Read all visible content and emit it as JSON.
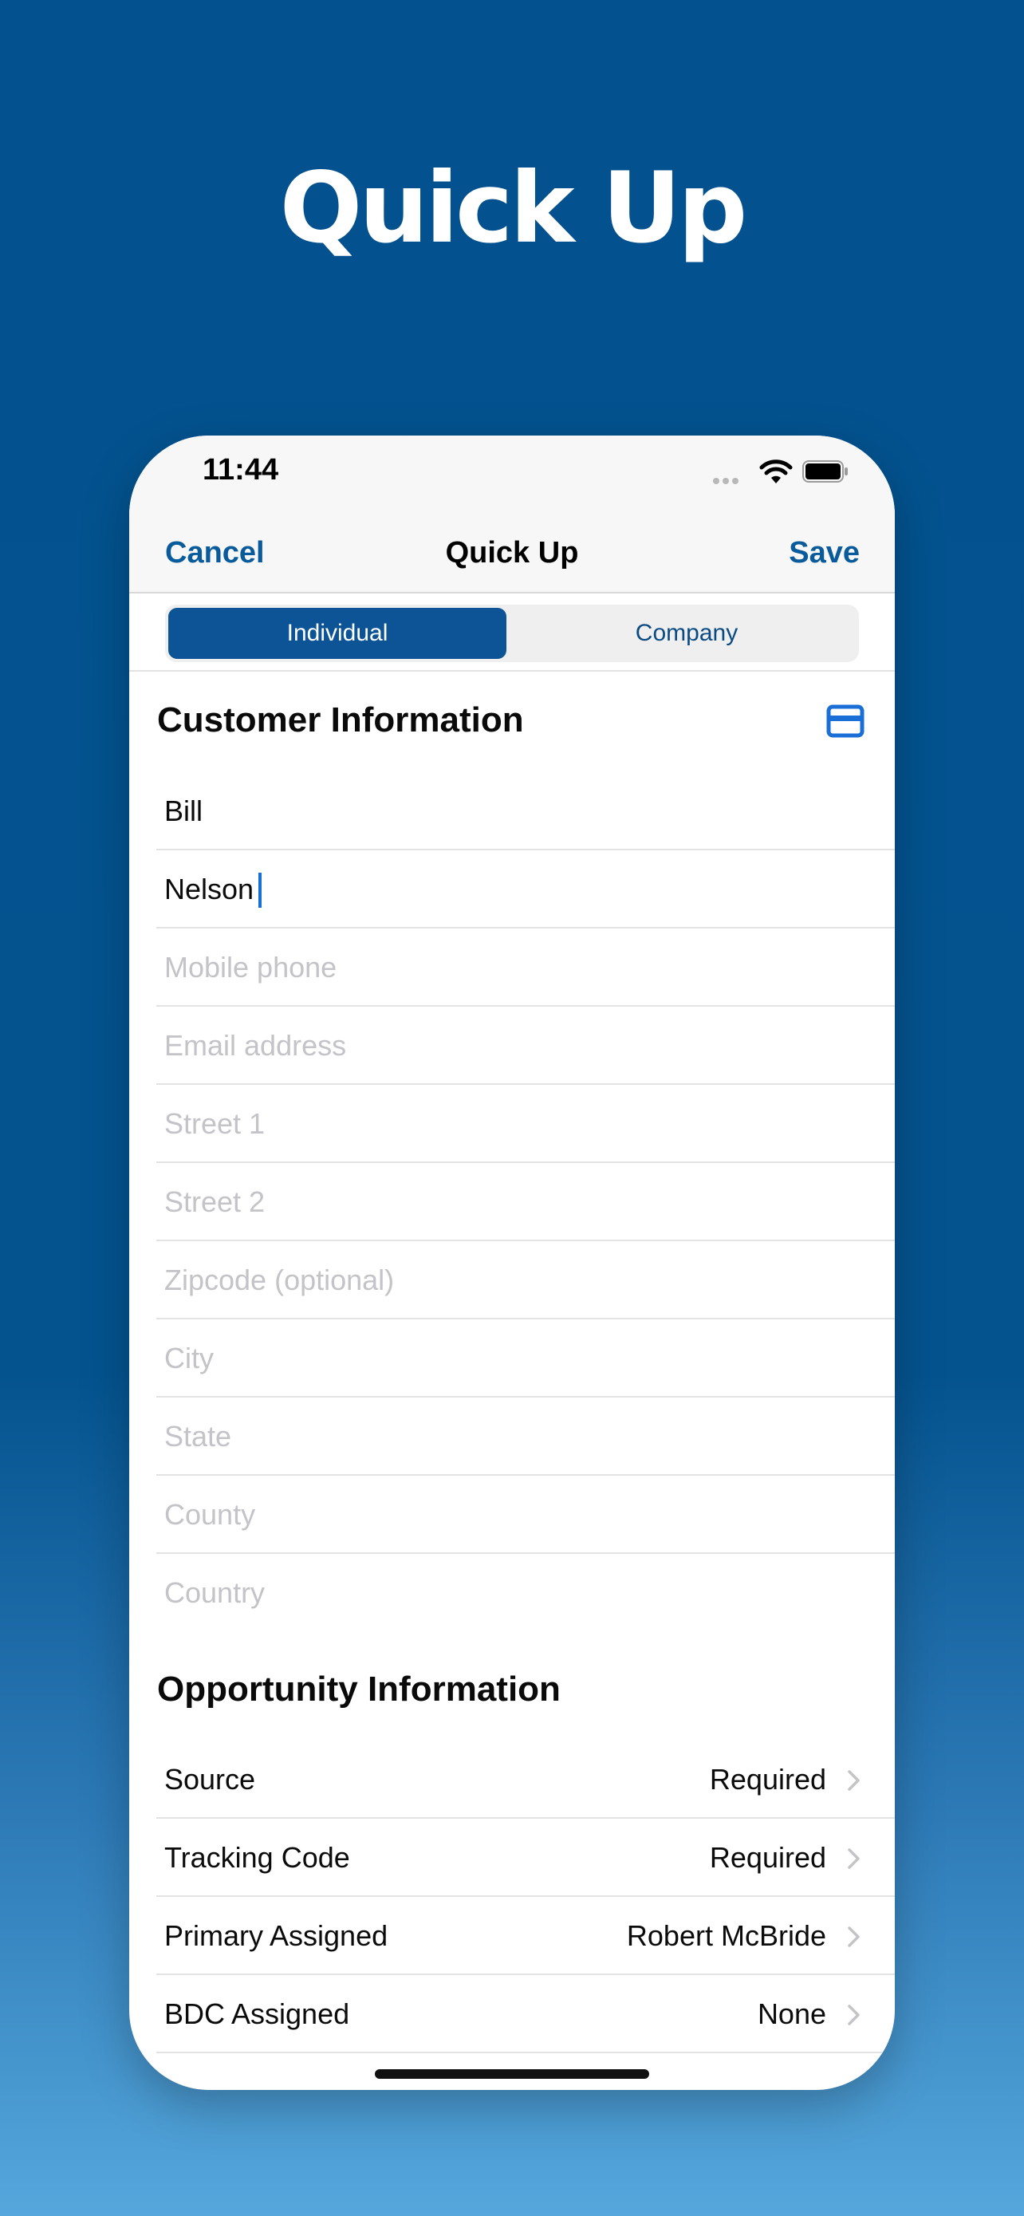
{
  "hero": {
    "title": "Quick Up"
  },
  "status_bar": {
    "time": "11:44"
  },
  "nav": {
    "cancel": "Cancel",
    "title": "Quick Up",
    "save": "Save"
  },
  "segment": {
    "individual": "Individual",
    "company": "Company",
    "selected": "Individual"
  },
  "customer": {
    "section_title": "Customer Information",
    "first_name": "Bill",
    "last_name": "Nelson",
    "placeholders": {
      "mobile_phone": "Mobile phone",
      "email": "Email address",
      "street1": "Street 1",
      "street2": "Street 2",
      "zipcode": "Zipcode (optional)",
      "city": "City",
      "state": "State",
      "county": "County",
      "country": "Country"
    }
  },
  "opportunity": {
    "section_title": "Opportunity Information",
    "rows": [
      {
        "label": "Source",
        "value": "Required"
      },
      {
        "label": "Tracking Code",
        "value": "Required"
      },
      {
        "label": "Primary Assigned",
        "value": "Robert McBride"
      },
      {
        "label": "BDC Assigned",
        "value": "None"
      }
    ]
  },
  "colors": {
    "brand_blue": "#0c5495",
    "link_blue": "#0a5b9b",
    "placeholder_gray": "#c3c3c8",
    "caret_blue": "#1a6fd6"
  },
  "icons": [
    "wifi-icon",
    "battery-icon",
    "card-icon",
    "chevron-right-icon"
  ]
}
